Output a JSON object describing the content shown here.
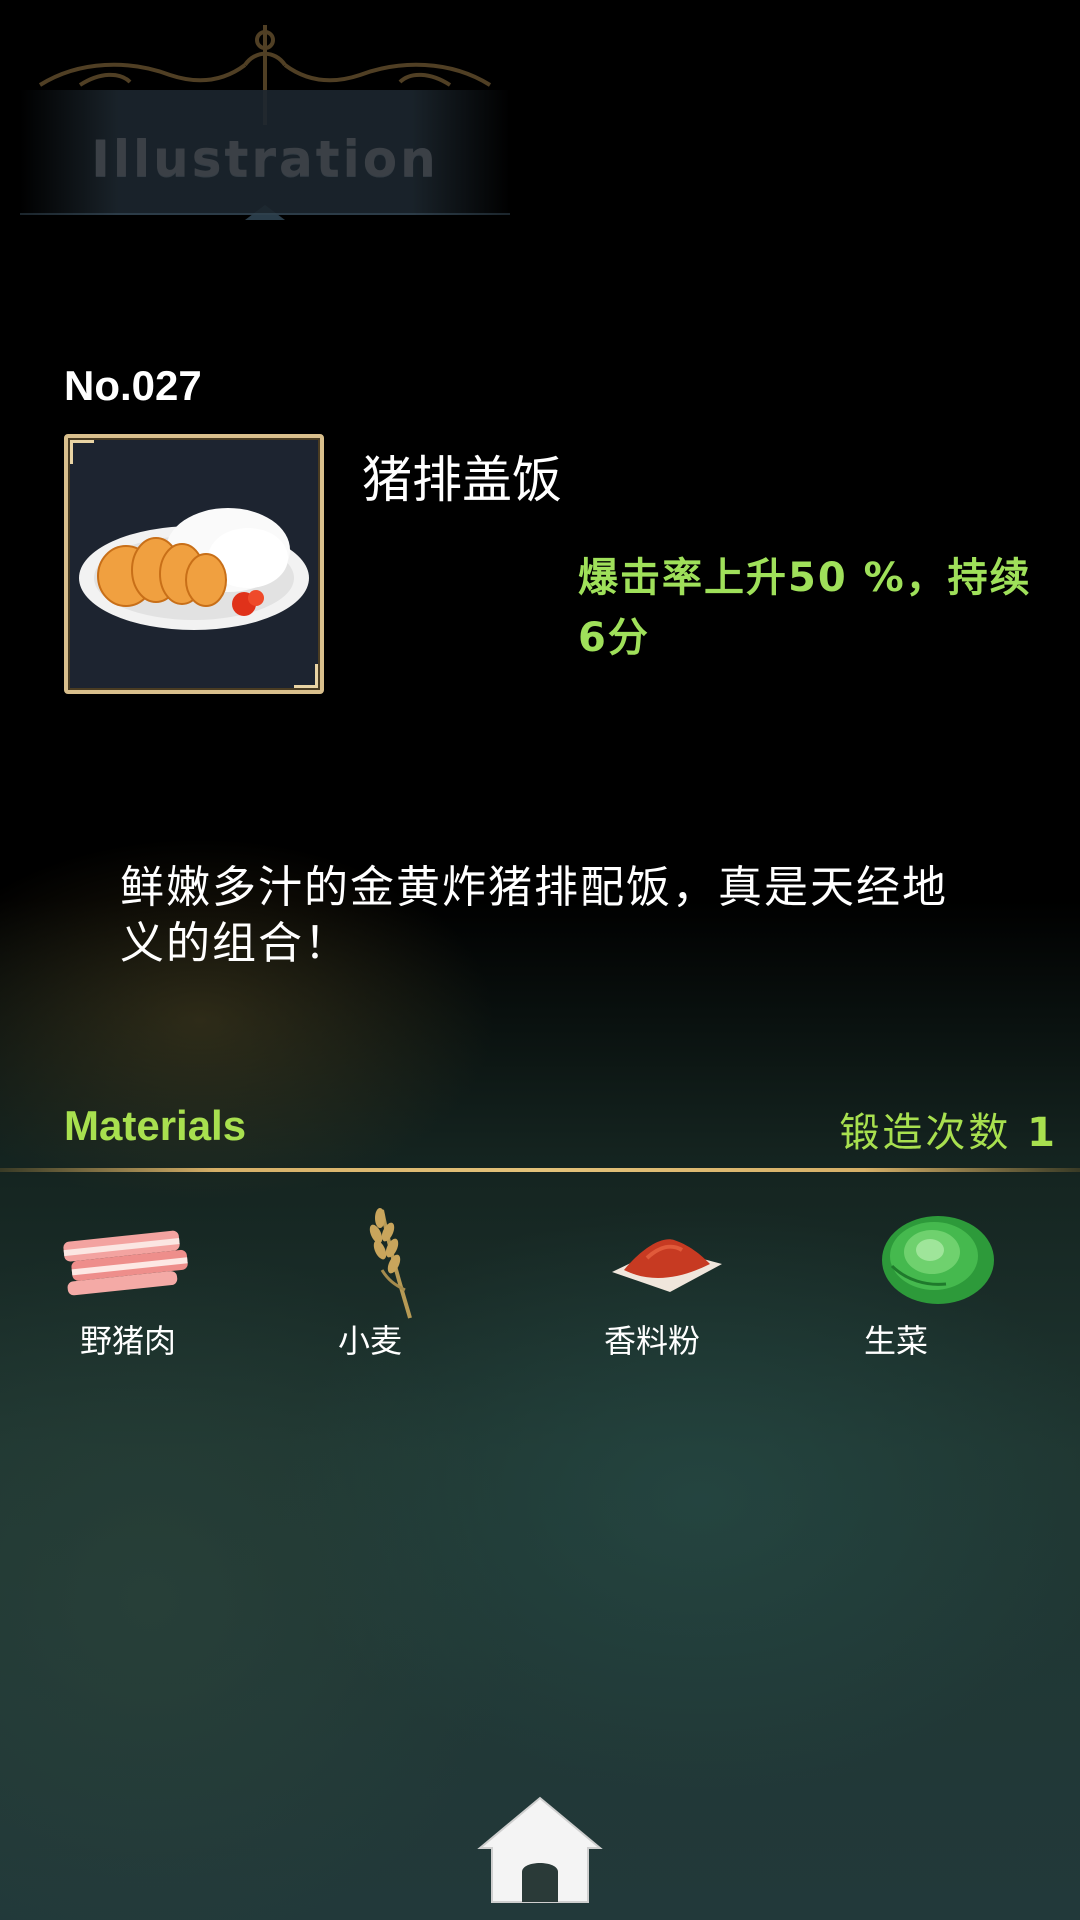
{
  "header": {
    "title": "Illustration"
  },
  "item": {
    "number": "No.027",
    "name": "猪排盖饭",
    "effect": "爆击率上升50 %，持续 6分",
    "description": "鲜嫩多汁的金黄炸猪排配饭，真是天经地义的组合！"
  },
  "materials": {
    "label": "Materials",
    "forge_label": "锻造次数",
    "forge_count": "1",
    "items": [
      {
        "name": "野猪肉",
        "icon": "bacon-icon"
      },
      {
        "name": "小麦",
        "icon": "wheat-icon"
      },
      {
        "name": "香料粉",
        "icon": "spice-powder-icon"
      },
      {
        "name": "生菜",
        "icon": "lettuce-icon"
      }
    ]
  },
  "nav": {
    "home_icon": "home-icon"
  },
  "colors": {
    "accent_green": "#a8e04f",
    "effect_green": "#9fe05a",
    "gold": "#d9bf8c",
    "background": "#000000"
  }
}
